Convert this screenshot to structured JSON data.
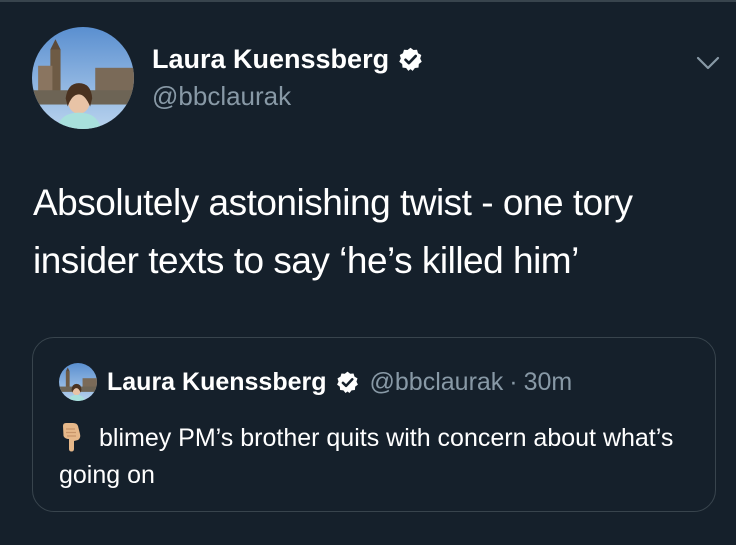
{
  "tweet": {
    "author_name": "Laura Kuenssberg",
    "author_handle": "@bbclaurak",
    "text": "Absolutely astonishing twist - one tory insider texts to say ‘he’s killed him’"
  },
  "quoted_tweet": {
    "author_name": "Laura Kuenssberg",
    "author_handle": "@bbclaurak",
    "separator": "·",
    "time": "30m",
    "text": "blimey PM’s brother quits with concern about what’s going on",
    "emoji": "backhand-index-pointing-down"
  },
  "icons": {
    "verified": "verified-badge-icon",
    "more": "chevron-down-icon",
    "pointing_hand": "pointing-down-hand-icon"
  },
  "colors": {
    "background": "#15202b",
    "secondary_text": "#8899a6",
    "border": "#38444d",
    "primary_text": "#ffffff",
    "verified_badge": "#ffffff"
  }
}
